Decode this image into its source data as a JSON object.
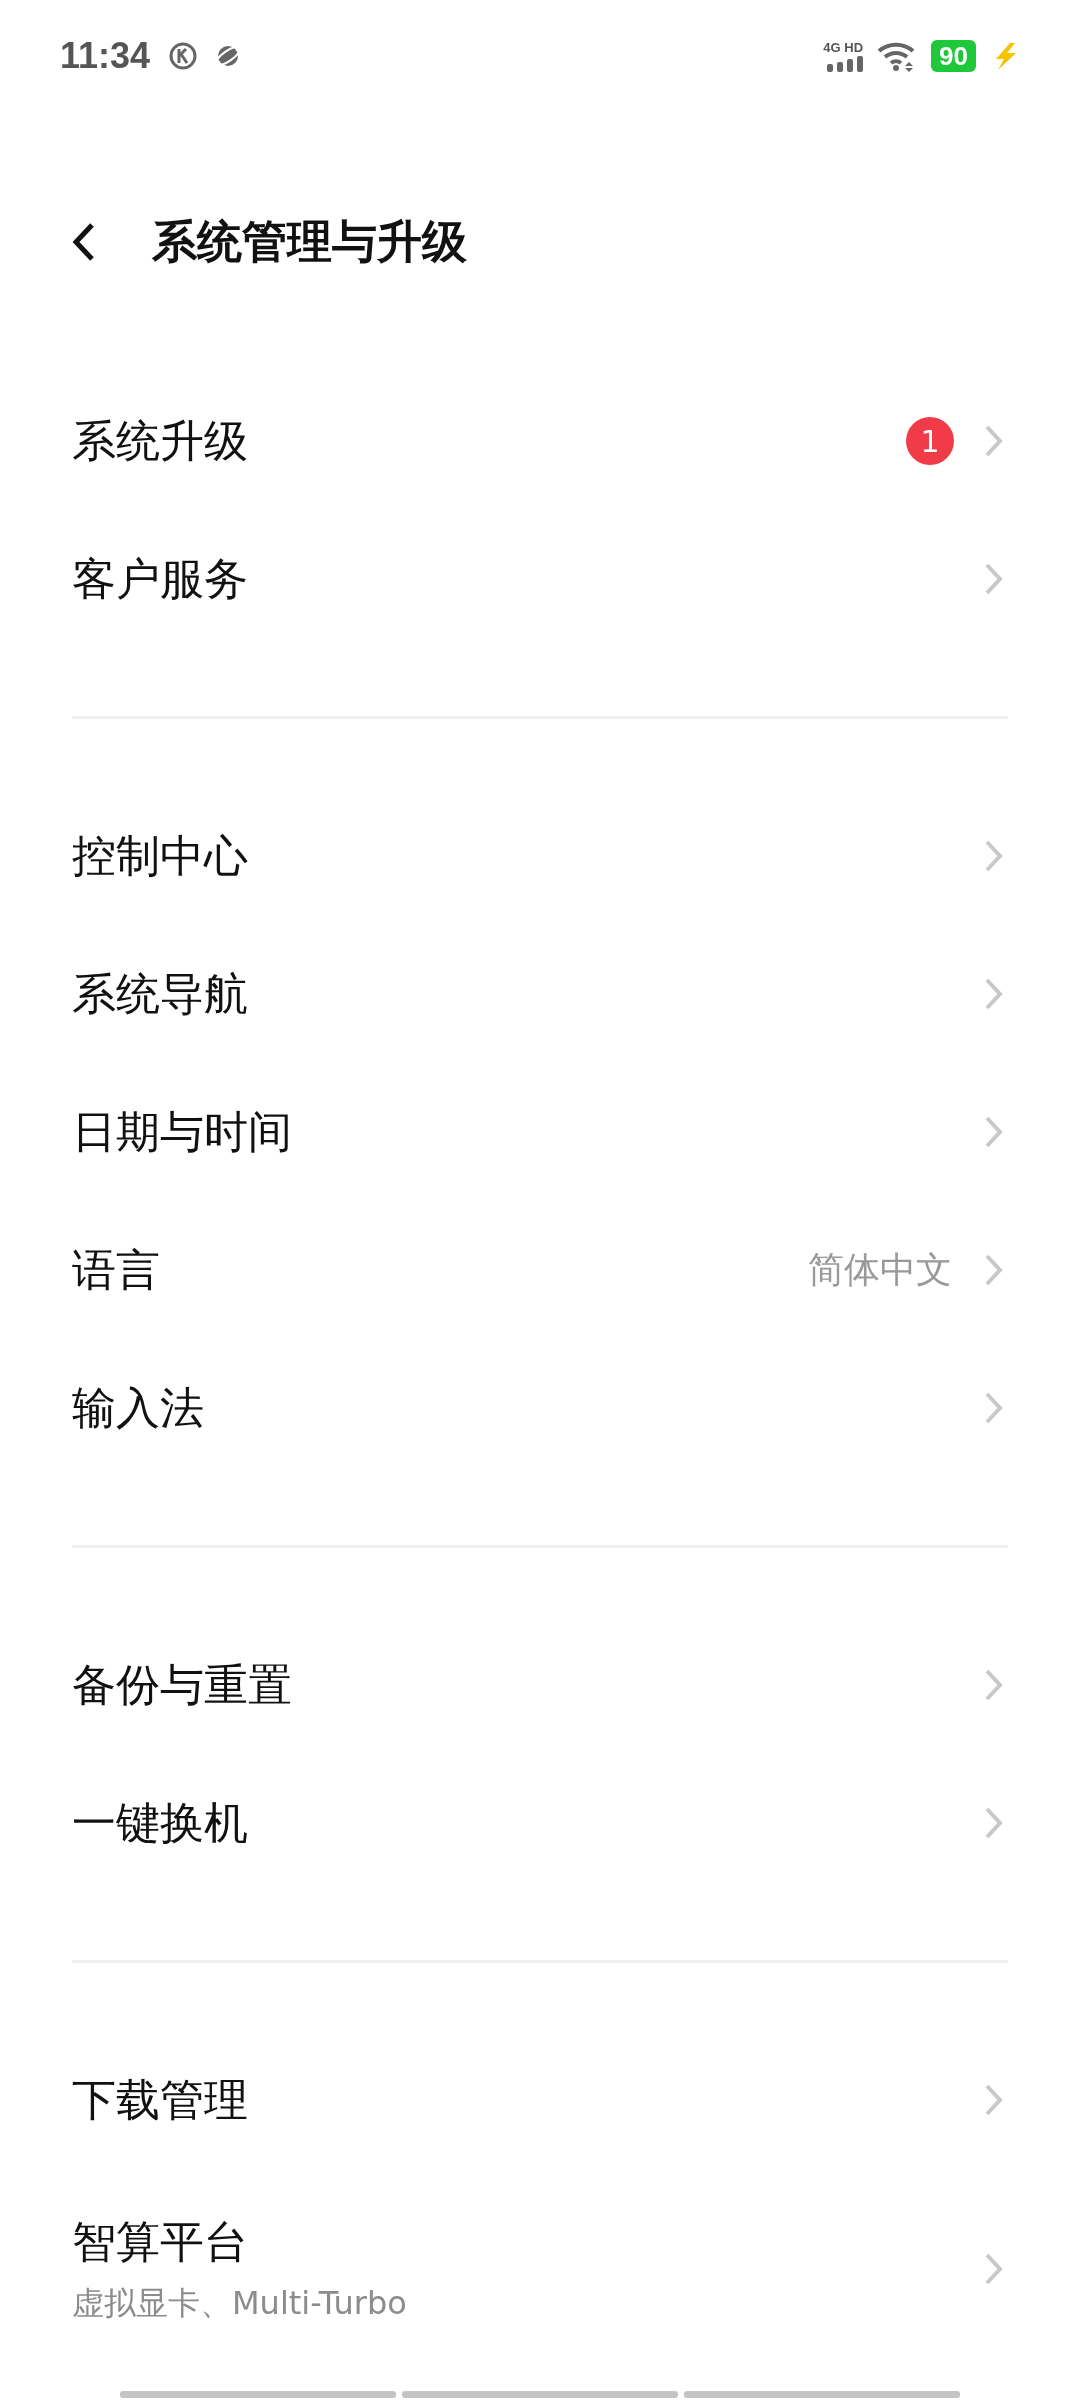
{
  "status_bar": {
    "time": "11:34",
    "network": "4G HD",
    "battery": "90"
  },
  "header": {
    "title": "系统管理与升级"
  },
  "sections": [
    {
      "items": [
        {
          "title": "系统升级",
          "badge": "1"
        },
        {
          "title": "客户服务"
        }
      ]
    },
    {
      "items": [
        {
          "title": "控制中心"
        },
        {
          "title": "系统导航"
        },
        {
          "title": "日期与时间"
        },
        {
          "title": "语言",
          "value": "简体中文"
        },
        {
          "title": "输入法"
        }
      ]
    },
    {
      "items": [
        {
          "title": "备份与重置"
        },
        {
          "title": "一键换机"
        }
      ]
    },
    {
      "items": [
        {
          "title": "下载管理"
        },
        {
          "title": "智算平台",
          "subtitle": "虚拟显卡、Multi-Turbo"
        }
      ]
    }
  ]
}
